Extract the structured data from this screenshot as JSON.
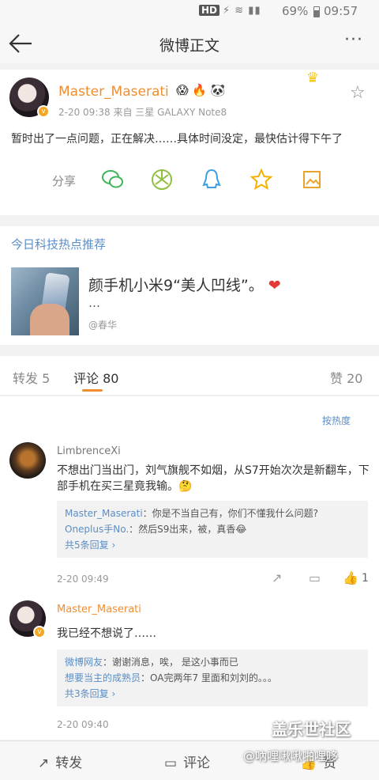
{
  "status_bar": {
    "hd": "HD",
    "signal_icons": "⚡ ≋ ▮▮",
    "battery": "69%",
    "time": "09:57"
  },
  "nav": {
    "title": "微博正文",
    "more": "···"
  },
  "post": {
    "username": "Master_Maserati",
    "badges": "😱 🔥 🐼",
    "meta": "2-20 09:38  来自 三星 GALAXY Note8",
    "content": "暂时出了一点问题，正在解决……具体时间没定，最快估计得下午了",
    "share_label": "分享",
    "share_icons": [
      "wechat-icon",
      "moments-icon",
      "qq-icon",
      "qzone-icon",
      "save-image-icon"
    ]
  },
  "hot": {
    "title": "今日科技热点推荐",
    "headline": "颜手机小米9“美人凹线”。",
    "ellipsis": "…",
    "source": "@春华"
  },
  "tabs": {
    "repost": "转发 5",
    "comment": "评论 80",
    "like": "赞 20"
  },
  "comments": {
    "sort_label": "按热度",
    "items": [
      {
        "name": "LimbrenceXi",
        "text": "不想出门当出门，刘气旗舰不如烟，从S7开始次次是新翻车，下部手机在买三星竟我输。🤔",
        "replies": [
          {
            "name": "Master_Maserati",
            "text": "：你是不当自己有，你们不懂我什么问题?"
          },
          {
            "name": "Oneplus手No.",
            "text": "：然后S9出来，被，真香😂"
          }
        ],
        "more_replies": "共5条回复 ›",
        "date": "2-20 09:49",
        "likes": "1"
      },
      {
        "name": "Master_Maserati",
        "text": "我已经不想说了……",
        "replies": [
          {
            "name": "微博网友",
            "text": "：谢谢消息，唉，   是这小事而已"
          },
          {
            "name": "想要当主的成熟员",
            "text": "：OA完两年7    里面和刘刘的。。。"
          }
        ],
        "more_replies": "共3条回复 ›",
        "date": "2-20 09:40",
        "likes": ""
      }
    ]
  },
  "bottom": {
    "repost": "转发",
    "comment": "评论",
    "like": "赞"
  },
  "watermark": {
    "line1": "盖乐世社区",
    "line2": "@吶哩啾啾啪哩哆"
  }
}
